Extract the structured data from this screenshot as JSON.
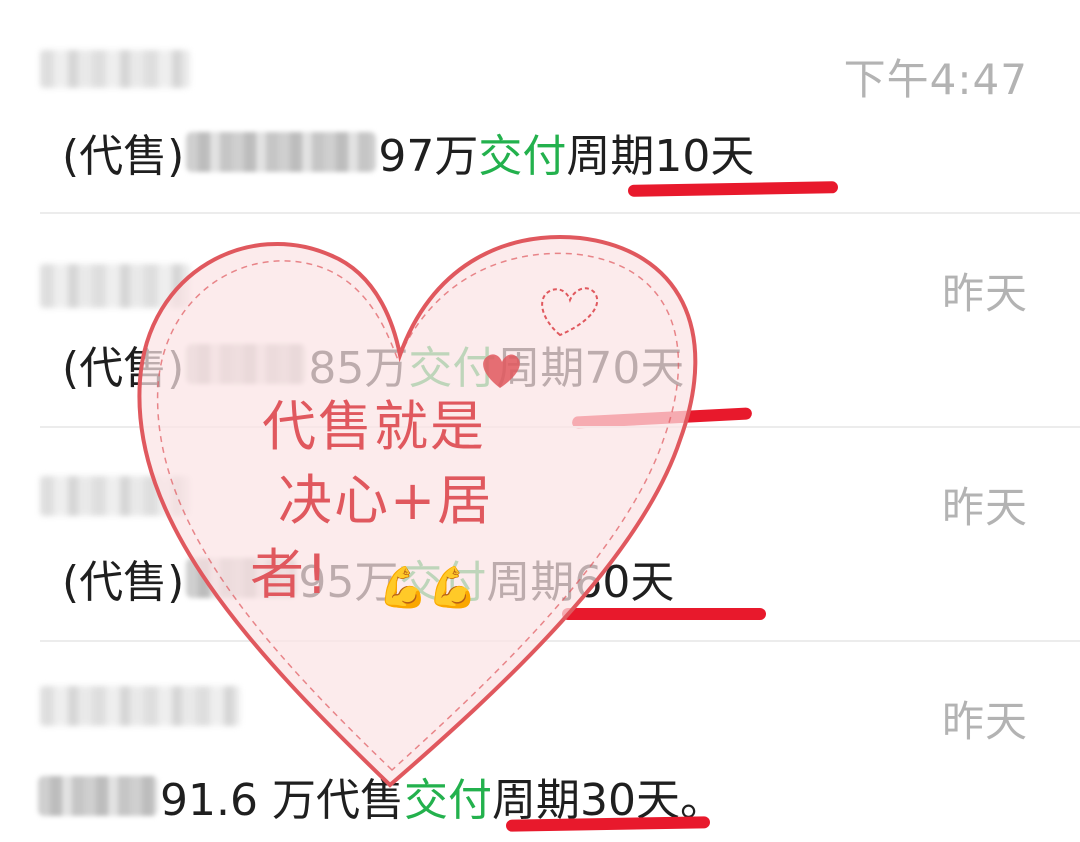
{
  "messages": [
    {
      "time": "下午4:47",
      "prefix": "(代售)",
      "amount_suffix": "97万",
      "green": "交付",
      "period": "周期10天",
      "tail": ""
    },
    {
      "time": "昨天",
      "prefix": "(代售)",
      "amount_suffix": "85万",
      "green": "交付",
      "period": "周期70天",
      "tail": ""
    },
    {
      "time": "昨天",
      "prefix": "(代售)",
      "amount_suffix": "95万",
      "green": "交付",
      "period": "周期60天",
      "tail": ""
    },
    {
      "time": "昨天",
      "prefix": "",
      "amount_suffix": "91.6 万代售",
      "green": "交付",
      "period": "周期30天",
      "tail": "。"
    }
  ],
  "overlay": {
    "line1": "代售就是",
    "line2": "决心+居",
    "line3": "者!",
    "emoji": "💪💪",
    "heart_color": "#e0585e"
  },
  "colors": {
    "highlight_green": "#23b14d",
    "underline_red": "#e8192c",
    "time_gray": "#b3b3b3"
  }
}
